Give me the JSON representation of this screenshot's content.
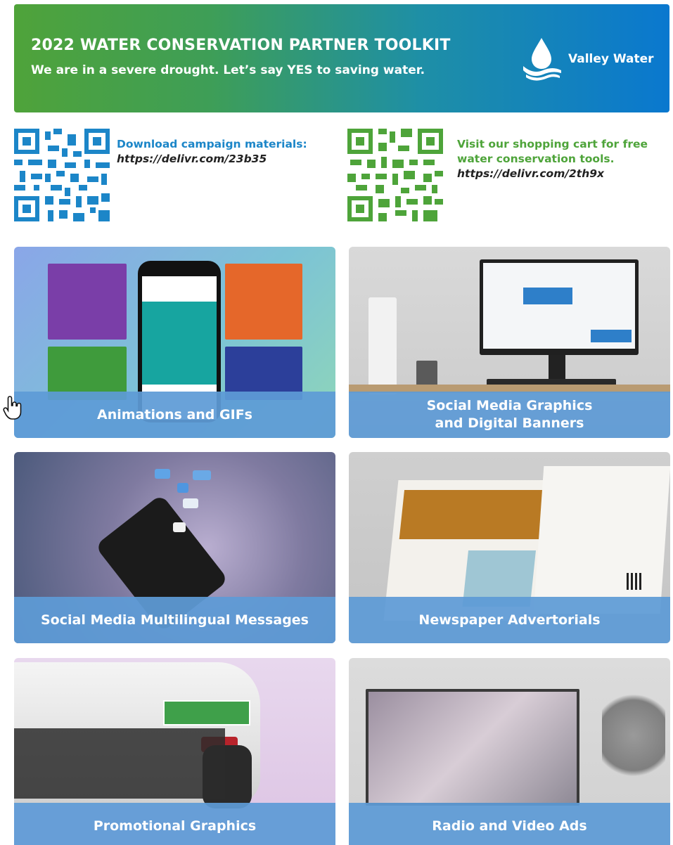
{
  "banner": {
    "title": "2022 WATER CONSERVATION PARTNER TOOLKIT",
    "subtitle": "We are in a severe drought. Let’s say YES to saving water.",
    "logo_text": "Valley Water"
  },
  "qr_left": {
    "heading": "Download campaign materials:",
    "url": "https://delivr.com/23b35"
  },
  "qr_right": {
    "heading_line1": "Visit our shopping cart for free",
    "heading_line2": "water conservation tools.",
    "url": "https://delivr.com/2th9x"
  },
  "tiles": [
    {
      "label": "Animations and GIFs"
    },
    {
      "label_line1": "Social Media Graphics",
      "label_line2": "and Digital Banners"
    },
    {
      "label": "Social Media Multilingual Messages"
    },
    {
      "label": "Newspaper Advertorials"
    },
    {
      "label": "Promotional Graphics"
    },
    {
      "label": "Radio and Video Ads"
    }
  ],
  "colors": {
    "banner_start": "#4fa33a",
    "banner_end": "#0a78cf",
    "qr_blue": "#1c86c8",
    "qr_green": "#4ea43a",
    "caption_bar": "#5e9bd6"
  },
  "icons": [
    "water-drop-logo-icon",
    "qr-code-icon",
    "hand-pointer-icon"
  ]
}
